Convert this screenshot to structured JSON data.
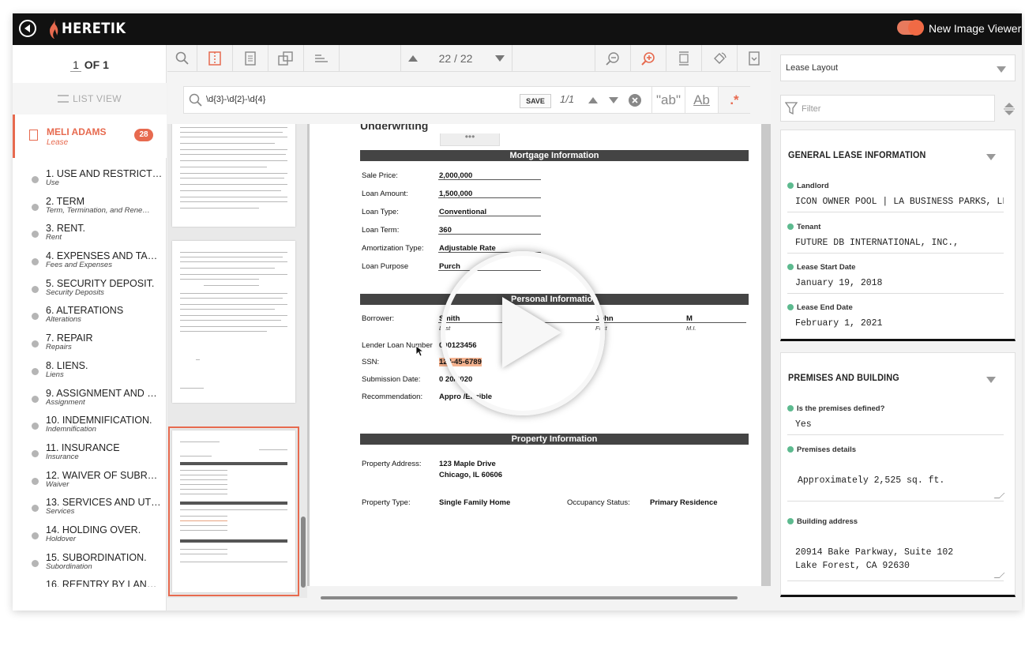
{
  "topbar": {
    "brand": "HERETIK",
    "viewer_label": "New Image Viewer",
    "accent": "#e76a4f"
  },
  "left": {
    "pager": {
      "current": "1",
      "total_label": "OF 1"
    },
    "list_view_label": "LIST VIEW",
    "document": {
      "name": "MELI ADAMS",
      "type": "Lease",
      "badge": "28"
    },
    "sections": [
      {
        "title": "1. USE AND RESTRICT…",
        "subtitle": "Use"
      },
      {
        "title": "2. TERM",
        "subtitle": "Term, Termination, and Rene…"
      },
      {
        "title": "3. RENT.",
        "subtitle": "Rent"
      },
      {
        "title": "4. EXPENSES AND TA…",
        "subtitle": "Fees and Expenses"
      },
      {
        "title": "5. SECURITY DEPOSIT.",
        "subtitle": "Security Deposits"
      },
      {
        "title": "6. ALTERATIONS",
        "subtitle": "Alterations"
      },
      {
        "title": "7. REPAIR",
        "subtitle": "Repairs"
      },
      {
        "title": "8. LIENS.",
        "subtitle": "Liens"
      },
      {
        "title": "9. ASSIGNMENT AND …",
        "subtitle": "Assignment"
      },
      {
        "title": "10. INDEMNIFICATION.",
        "subtitle": "Indemnification"
      },
      {
        "title": "11. INSURANCE",
        "subtitle": "Insurance"
      },
      {
        "title": "12. WAIVER OF SUBR…",
        "subtitle": "Waiver"
      },
      {
        "title": "13. SERVICES AND UT…",
        "subtitle": "Services"
      },
      {
        "title": "14. HOLDING OVER.",
        "subtitle": "Holdover"
      },
      {
        "title": "15. SUBORDINATION.",
        "subtitle": "Subordination"
      },
      {
        "title": "16. REENTRY BY LAN…",
        "subtitle": ""
      }
    ]
  },
  "toolbar": {
    "page_count": "22 / 22"
  },
  "search": {
    "query": "\\d{3}-\\d{2}-\\d{4}",
    "save_label": "SAVE",
    "hits": "1/1",
    "opt_match_word": "\"ab\"",
    "opt_match_case": "Ab",
    "opt_regex": ".*"
  },
  "document_page": {
    "underwriting_label": "Underwriting",
    "tab_dots": "•••",
    "mortgage": {
      "header": "Mortgage Information",
      "rows": [
        {
          "label": "Sale Price:",
          "value": "2,000,000"
        },
        {
          "label": "Loan Amount:",
          "value": "1,500,000"
        },
        {
          "label": "Loan Type:",
          "value": "Conventional"
        },
        {
          "label": "Loan Term:",
          "value": "360"
        },
        {
          "label": "Amortization Type:",
          "value": "Adjustable Rate"
        },
        {
          "label": "Loan Purpose",
          "value": "Purch"
        }
      ]
    },
    "personal": {
      "header": "Personal Information",
      "borrower_label": "Borrower:",
      "last_name": "Smith",
      "last_caption": "Last",
      "first_name": "John",
      "first_caption": "First",
      "middle_initial": "M",
      "mi_caption": "M.I.",
      "lender_label": "Lender Loan Number",
      "lender_value": "000123456",
      "ssn_label": "SSN:",
      "ssn_value": "123-45-6789",
      "submission_label": "Submission Date:",
      "submission_value": "0  20/2020",
      "recommendation_label": "Recommendation:",
      "recommendation_value": "Appro  /Eligible"
    },
    "property": {
      "header": "Property Information",
      "address_label": "Property Address:",
      "address_line1": "123 Maple Drive",
      "address_line2": "Chicago, IL 60606",
      "type_label": "Property Type:",
      "type_value": "Single Family Home",
      "occupancy_label": "Occupancy Status:",
      "occupancy_value": "Primary Residence"
    }
  },
  "right": {
    "layout_select": "Lease Layout",
    "filter_placeholder": "Filter",
    "general": {
      "title": "GENERAL LEASE INFORMATION",
      "fields": [
        {
          "label": "Landlord",
          "value": "ICON OWNER POOL | LA BUSINESS PARKS, LLC,"
        },
        {
          "label": "Tenant",
          "value": "FUTURE DB INTERNATIONAL, INC.,"
        },
        {
          "label": "Lease Start Date",
          "value": "January 19, 2018"
        },
        {
          "label": "Lease End Date",
          "value": "February 1, 2021"
        }
      ]
    },
    "premises": {
      "title": "PREMISES AND BUILDING",
      "fields": [
        {
          "label": "Is the premises defined?",
          "value": "Yes"
        },
        {
          "label": "Premises details",
          "value": "Approximately 2,525 sq. ft."
        },
        {
          "label": "Building address",
          "value": "20914 Bake Parkway, Suite 102\nLake Forest, CA 92630"
        }
      ]
    },
    "dot_color": "#5dba8f"
  }
}
